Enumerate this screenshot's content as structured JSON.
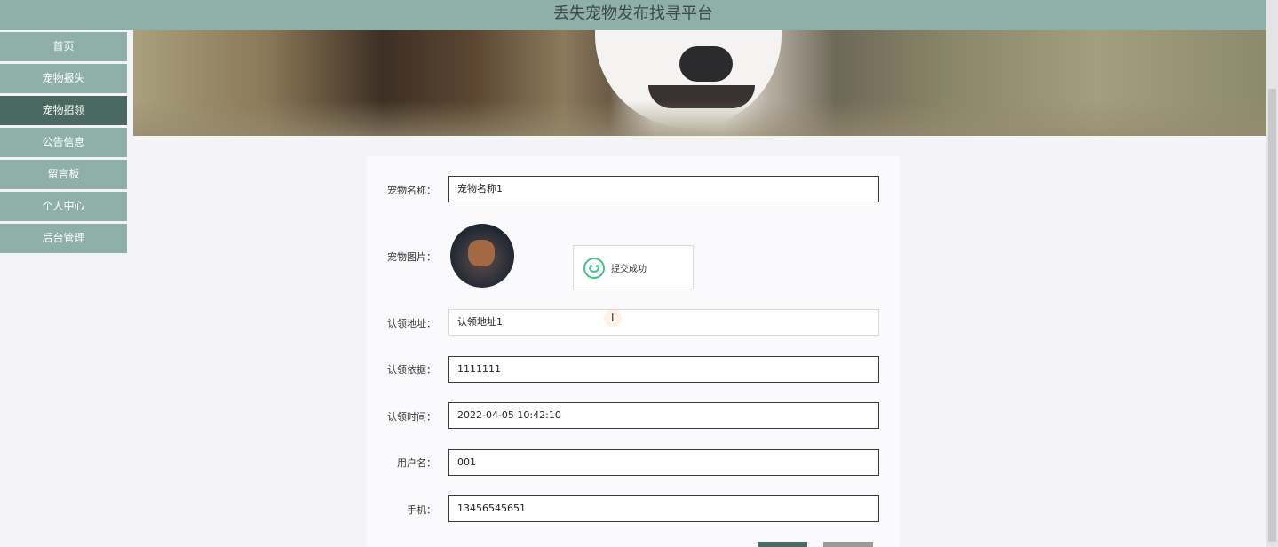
{
  "app": {
    "title": "丢失宠物发布找寻平台"
  },
  "nav": {
    "items": [
      {
        "label": "首页"
      },
      {
        "label": "宠物报失"
      },
      {
        "label": "宠物招领"
      },
      {
        "label": "公告信息"
      },
      {
        "label": "留言板"
      },
      {
        "label": "个人中心"
      },
      {
        "label": "后台管理"
      }
    ],
    "active": "宠物招领"
  },
  "form": {
    "pet_name": {
      "label": "宠物名称：",
      "value": "宠物名称1"
    },
    "pet_image": {
      "label": "宠物图片："
    },
    "claim_address": {
      "label": "认领地址：",
      "value": "认领地址1"
    },
    "claim_basis": {
      "label": "认领依据：",
      "value": "1111111"
    },
    "claim_time": {
      "label": "认领时间：",
      "value": "2022-04-05 10:42:10"
    },
    "username": {
      "label": "用户名：",
      "value": "001"
    },
    "phone": {
      "label": "手机：",
      "value": "13456545651"
    }
  },
  "toast": {
    "message": "提交成功",
    "icon": "smile-icon"
  },
  "colors": {
    "topbar": "#8fb0a8",
    "nav_active": "#4a6960",
    "success": "#3cc48a"
  }
}
